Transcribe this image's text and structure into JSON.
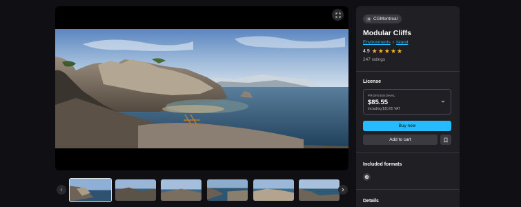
{
  "viewer": {
    "expand_icon": "expand-icon",
    "thumbnails": [
      {
        "name": "thumb-1",
        "active": true
      },
      {
        "name": "thumb-2",
        "active": false
      },
      {
        "name": "thumb-3",
        "active": false
      },
      {
        "name": "thumb-4",
        "active": false
      },
      {
        "name": "thumb-5",
        "active": false
      },
      {
        "name": "thumb-6",
        "active": false
      }
    ]
  },
  "product": {
    "publisher": "CGMontreal",
    "title": "Modular Cliffs",
    "breadcrumbs": [
      "Environments",
      "Island"
    ],
    "rating": "4.9",
    "stars": 5,
    "ratings_count": "247 ratings"
  },
  "license": {
    "heading": "License",
    "tier": "PROFESSIONAL",
    "price": "$85.55",
    "vat_note": "Including $10.05 VAT"
  },
  "actions": {
    "buy_now": "Buy now",
    "add_to_cart": "Add to cart"
  },
  "sections": {
    "included_formats": "Included formats",
    "details": "Details"
  },
  "colors": {
    "accent": "#26bbff",
    "star": "#f5b82e",
    "background": "#101014",
    "panel": "#202024"
  }
}
